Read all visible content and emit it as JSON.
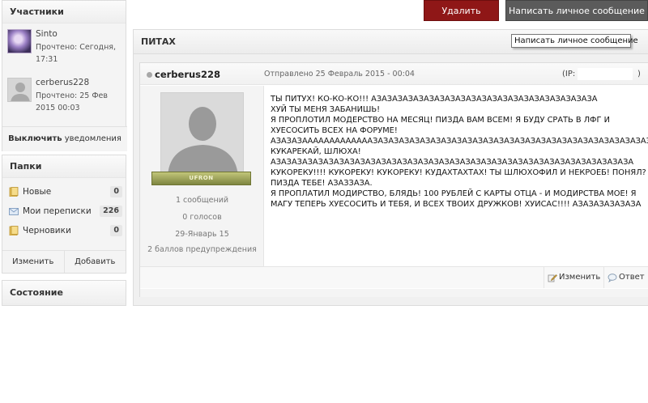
{
  "sidebar": {
    "participants_title": "Участники",
    "participants": [
      {
        "name": "Sinto",
        "read_status": "Прочтено: Сегодня, 17:31"
      },
      {
        "name": "cerberus228",
        "read_status": "Прочтено: 25 Фев 2015 00:03"
      }
    ],
    "mute_bold": "Выключить",
    "mute_rest": " уведомления",
    "folders_title": "Папки",
    "folders": [
      {
        "label": "Новые",
        "count": "0",
        "icon": "folder-icon"
      },
      {
        "label": "Мои переписки",
        "count": "226",
        "icon": "mail-icon"
      },
      {
        "label": "Черновики",
        "count": "0",
        "icon": "folder-icon"
      }
    ],
    "edit_label": "Изменить",
    "add_label": "Добавить",
    "state_title": "Состояние"
  },
  "toolbar": {
    "delete_label": "Удалить",
    "new_pm_label": "Написать личное сообщение",
    "tooltip": "Написать личное сообщение"
  },
  "conversation": {
    "title": "ПИТАХ"
  },
  "post": {
    "author": "cerberus228",
    "date": "Отправлено 25 Февраль 2015 - 00:04",
    "ip_label": "(IP:",
    "ip_close": ")",
    "rank": "UFRON",
    "stats": [
      "1 сообщений",
      "0 голосов",
      "29-Январь 15",
      "2 баллов предупреждения"
    ],
    "lines": [
      "ТЫ ПИТУХ! КО-КО-КО!!! АЗАЗАЗАЗАЗАЗАЗАЗАЗАЗАЗАЗАЗАЗАЗАЗАЗАЗАЗАЗАЗА",
      "ХУЙ ТЫ МЕНЯ ЗАБАНИШЬ!",
      "Я ПРОПЛОТИЛ МОДЕРСТВО НА МЕСЯЦ! ПИЗДА ВАМ ВСЕМ! Я БУДУ СРАТЬ В ЛФГ И",
      "ХУЕСОСИТЬ ВСЕХ НА ФОРУМЕ!",
      "АЗАЗАЗАААААААААААААЗАЗАЗАЗАЗАЗАЗАЗАЗАЗАЗАЗАЗАЗАЗАЗАЗАЗАЗАЗАЗАЗАЗАЗАЗАЗАЗАЗАЗАЗАЗА",
      "КУКАРЕКАЙ, ШЛЮХА!",
      "АЗАЗАЗАЗАЗАЗАЗАЗАЗАЗАЗАЗАЗАЗАЗАЗАЗАЗАЗАЗАЗАЗАЗАЗАЗАЗАЗАЗАЗАЗАЗАЗАЗАЗА",
      "КУКОРЕКУ!!!! КУКОРЕКУ! КУКОРЕКУ! КУДАХТАХТАХ! ТЫ ШЛЮХОФИЛ И НЕКРОЕБ! ПОНЯЛ?",
      "ПИЗДА ТЕБЕ! АЗАЗЗАЗА.",
      "Я ПРОПЛАТИЛ МОДИРСТВО, БЛЯДЬ! 100 РУБЛЕЙ С КАРТЫ ОТЦА - И МОДИРСТВА МОЕ! Я",
      "МАГУ ТЕПЕРЬ ХУЕСОСИТЬ И ТЕБЯ, И ВСЕХ ТВОИХ ДРУЖКОВ! ХУИСАС!!!! АЗАЗАЗАЗАЗАЗА"
    ],
    "edit_label": "Изменить",
    "reply_label": "Ответ"
  }
}
